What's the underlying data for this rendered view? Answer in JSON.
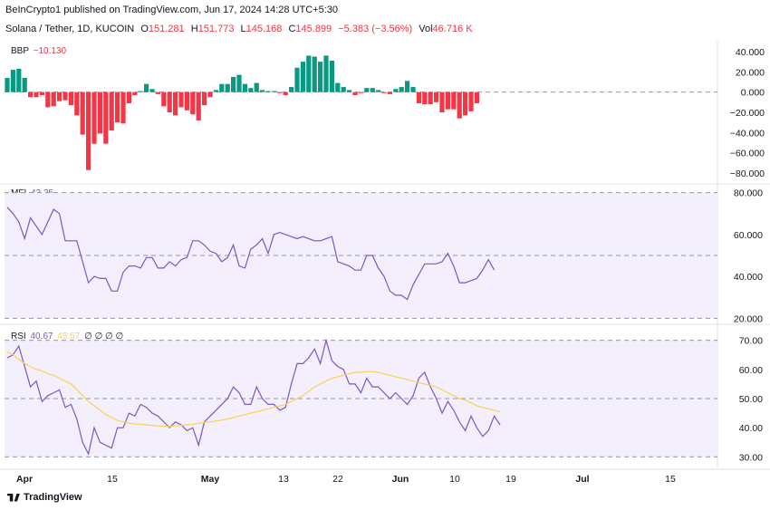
{
  "header": {
    "line1": "BeInCrypto1 published on TradingView.com, Jun 17, 2024 14:28 UTC+5:30",
    "symbol": "Solana / Tether, 1D, KUCOIN",
    "o_label": "O",
    "o_value": "151.281",
    "h_label": "H",
    "h_value": "151.773",
    "l_label": "L",
    "l_value": "145.168",
    "c_label": "C",
    "c_value": "145.899",
    "change": "−5.383 (−3.56%)",
    "vol_label": "Vol",
    "vol_value": "46.716 K"
  },
  "panes": {
    "bbp": {
      "name": "BBP",
      "value": "−10.130"
    },
    "mfi": {
      "name": "MFI",
      "value": "43.25"
    },
    "rsi": {
      "name": "RSI",
      "value": "40.67",
      "value2": "45.57",
      "extra": "∅ ∅ ∅ ∅"
    }
  },
  "colors": {
    "up": "#089981",
    "down": "#f23645",
    "mfi_line": "#7e57c2",
    "rsi_line": "#7e57c2",
    "rsi_ma": "#f7d354",
    "band_fill": "#f3effc"
  },
  "watermark": {
    "brand": "TradingView"
  },
  "chart_data": [
    {
      "type": "bar",
      "name": "BBP",
      "yticks": [
        "40.000",
        "20.000",
        "0.000",
        "−20.000",
        "−40.000",
        "−60.000",
        "−80.000"
      ],
      "ylim": [
        -88000,
        48000
      ],
      "values": [
        14000,
        22000,
        23000,
        14000,
        -5000,
        -5000,
        -3000,
        -15000,
        -14000,
        -9000,
        -8000,
        -13000,
        -23000,
        -42000,
        -77000,
        -51000,
        -41000,
        -51000,
        -38000,
        -30000,
        -31000,
        -11000,
        -3000,
        1000,
        8000,
        3000,
        -2000,
        -14000,
        -20000,
        -23000,
        -15000,
        -18000,
        -22000,
        -28000,
        -13000,
        -5000,
        2000,
        8000,
        8000,
        15000,
        17000,
        8000,
        4000,
        9000,
        2000,
        1000,
        1000,
        -1000,
        -3000,
        5000,
        24000,
        30000,
        36000,
        35000,
        30000,
        36000,
        31000,
        9000,
        5000,
        2000,
        -3000,
        -1000,
        4000,
        4000,
        2000,
        -1000,
        -2000,
        3000,
        5000,
        11000,
        5000,
        -11000,
        -12000,
        -12000,
        -10000,
        -20000,
        -17000,
        -17000,
        -26000,
        -23000,
        -19000,
        -11000
      ]
    },
    {
      "type": "line",
      "name": "MFI",
      "yticks": [
        "80.000",
        "60.000",
        "40.000",
        "20.000"
      ],
      "ylim": [
        18,
        82
      ],
      "band": [
        20,
        80
      ],
      "midline": 50,
      "values": [
        73,
        70,
        66,
        58,
        68,
        64,
        60,
        66,
        72,
        70,
        57,
        57,
        57,
        47,
        37,
        40,
        39,
        39,
        33,
        33,
        42,
        45,
        45,
        44,
        49,
        49,
        44,
        44,
        47,
        45,
        48,
        49,
        57,
        57,
        55,
        52,
        51,
        47,
        49,
        55,
        45,
        44,
        53,
        55,
        58,
        51,
        60,
        61,
        60,
        59,
        58,
        59,
        58,
        57,
        57,
        58,
        59,
        47,
        46,
        45,
        43,
        43,
        50,
        50,
        44,
        40,
        33,
        31,
        31,
        29,
        36,
        41,
        46,
        46,
        46,
        47,
        51,
        45,
        37,
        37,
        38,
        39,
        43,
        48,
        43
      ]
    },
    {
      "type": "line",
      "name": "RSI",
      "yticks": [
        "70.00",
        "60.00",
        "50.00",
        "40.00",
        "30.00"
      ],
      "ylim": [
        27,
        73
      ],
      "band": [
        30,
        70
      ],
      "midline": 50,
      "x_labels": [
        "Apr",
        "15",
        "May",
        "13",
        "22",
        "Jun",
        "10",
        "19",
        "Jul",
        "15"
      ],
      "series": [
        {
          "name": "RSI",
          "values": [
            64,
            65,
            68,
            61,
            54,
            56,
            49,
            51,
            52,
            53,
            47,
            48,
            43,
            35,
            31,
            40,
            35,
            34,
            33,
            40,
            40,
            45,
            44,
            48,
            47,
            45,
            44,
            42,
            40,
            42,
            41,
            39,
            40,
            34,
            42,
            44,
            46,
            48,
            50,
            54,
            52,
            48,
            48,
            54,
            50,
            48,
            48,
            46,
            47,
            55,
            62,
            62,
            64,
            67,
            62,
            70,
            63,
            61,
            60,
            55,
            55,
            52,
            57,
            54,
            54,
            52,
            50,
            52,
            50,
            48,
            51,
            57,
            59,
            54,
            50,
            45,
            49,
            46,
            42,
            39,
            44,
            40,
            37,
            39,
            44,
            41
          ]
        },
        {
          "name": "RSI-MA",
          "values": [
            66,
            65,
            63.5,
            62,
            61,
            60,
            59.5,
            58.5,
            58,
            57,
            56,
            55,
            53,
            51,
            49,
            47.5,
            46,
            44.5,
            43.5,
            42.5,
            42,
            41.5,
            41.3,
            41.2,
            41,
            40.8,
            40.6,
            40.5,
            40.4,
            40.6,
            40.8,
            41,
            41.2,
            41.5,
            41.8,
            42,
            42.3,
            42.6,
            43,
            43.5,
            44,
            44.5,
            45,
            45.5,
            46,
            46.5,
            47,
            47.5,
            48,
            49,
            50,
            51,
            52.5,
            54,
            55,
            56,
            57,
            57.5,
            58,
            58.5,
            59,
            59,
            59.3,
            59.3,
            59,
            58.5,
            58,
            57.5,
            57,
            56.5,
            56,
            55.5,
            55,
            54.5,
            54,
            53,
            52,
            51,
            50,
            49.5,
            48.5,
            47.5,
            47,
            46.5,
            46,
            45.5
          ]
        }
      ]
    }
  ]
}
